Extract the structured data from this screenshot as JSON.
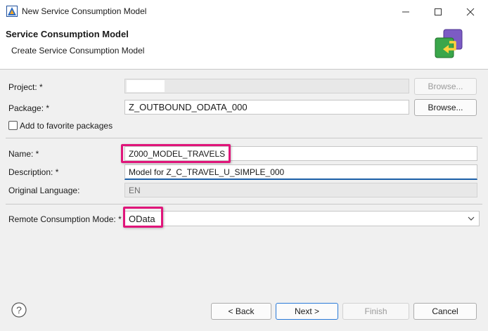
{
  "window": {
    "title": "New Service Consumption Model"
  },
  "header": {
    "title": "Service Consumption Model",
    "subtitle": "Create Service Consumption Model"
  },
  "form": {
    "project": {
      "label": "Project: *",
      "value": "",
      "browse_label": "Browse..."
    },
    "package": {
      "label": "Package: *",
      "value": "Z_OUTBOUND_ODATA_000",
      "browse_label": "Browse..."
    },
    "favorite": {
      "label": "Add to favorite packages",
      "checked": false
    },
    "name": {
      "label": "Name: *",
      "value": "Z000_MODEL_TRAVELS"
    },
    "description": {
      "label": "Description: *",
      "value": "Model for Z_C_TRAVEL_U_SIMPLE_000"
    },
    "original_language": {
      "label": "Original Language:",
      "value": "EN"
    },
    "remote_mode": {
      "label": "Remote Consumption Mode: *",
      "value": "OData"
    }
  },
  "footer": {
    "back_label": "< Back",
    "next_label": "Next >",
    "finish_label": "Finish",
    "cancel_label": "Cancel"
  },
  "colors": {
    "highlight": "#e0157a",
    "focus": "#1b5fa8",
    "default_button": "#2a7ad8"
  }
}
